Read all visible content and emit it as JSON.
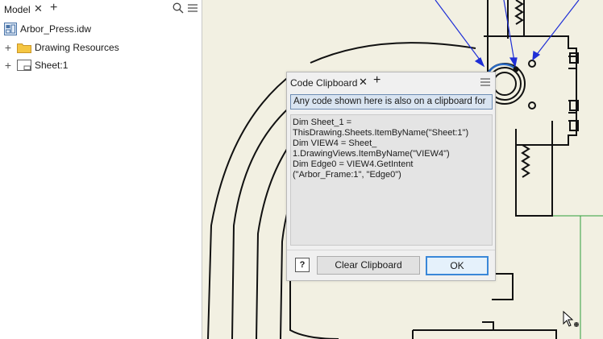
{
  "browser": {
    "tab_label": "Model",
    "tab_close_icon": "close-icon",
    "tab_add_icon": "plus-icon",
    "search_icon": "search-icon",
    "menu_icon": "hamburger-menu-icon",
    "tree": [
      {
        "label": "Arbor_Press.idw",
        "icon": "drawing-document-icon"
      },
      {
        "label": "Drawing Resources",
        "icon": "folder-icon"
      },
      {
        "label": "Sheet:1",
        "icon": "sheet-icon"
      }
    ]
  },
  "dialog": {
    "title": "Code Clipboard",
    "info": "Any code shown here is also on a clipboard for",
    "code_lines": [
      "Dim Sheet_1 =",
      "ThisDrawing.Sheets.ItemByName(\"Sheet:1\")",
      "Dim VIEW4 = Sheet_",
      "1.DrawingViews.ItemByName(\"VIEW4\")",
      "Dim Edge0 = VIEW4.GetIntent",
      "(\"Arbor_Frame:1\", \"Edge0\")"
    ],
    "help_label": "?",
    "clear_button": "Clear Clipboard",
    "ok_button": "OK"
  },
  "colors": {
    "canvas_background": "#f2f0e2",
    "drawing_lines": "#111111",
    "annotation_arrows": "#1f2fd6",
    "guide_line": "#2e9e3a",
    "selection_dot": "#2a6ac4"
  }
}
